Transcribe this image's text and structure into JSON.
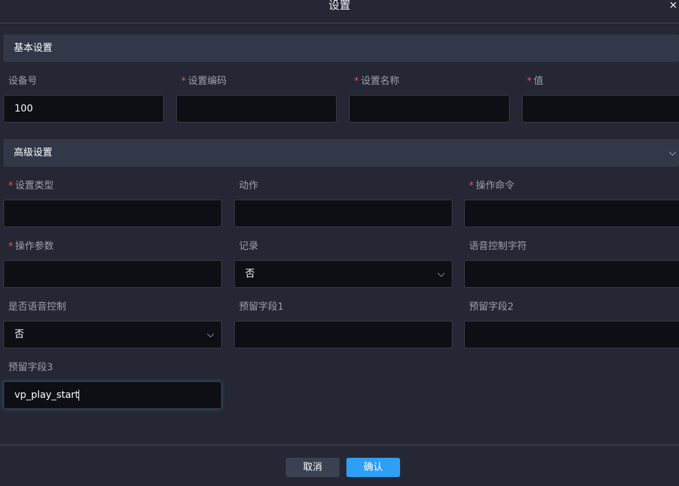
{
  "dialog": {
    "title": "设置",
    "close_icon": "close-icon"
  },
  "basic": {
    "title": "基本设置",
    "fields": [
      {
        "label": "设备号",
        "required": false,
        "value": "100"
      },
      {
        "label": "设置编码",
        "required": true,
        "value": ""
      },
      {
        "label": "设置名称",
        "required": true,
        "value": ""
      },
      {
        "label": "值",
        "required": true,
        "value": ""
      }
    ]
  },
  "advanced": {
    "title": "高级设置",
    "fields": [
      {
        "label": "设置类型",
        "required": true,
        "value": ""
      },
      {
        "label": "动作",
        "required": false,
        "value": ""
      },
      {
        "label": "操作命令",
        "required": true,
        "value": ""
      },
      {
        "label": "操作参数",
        "required": true,
        "value": ""
      },
      {
        "label": "记录",
        "required": false,
        "value": "否",
        "type": "select"
      },
      {
        "label": "语音控制字符",
        "required": false,
        "value": ""
      },
      {
        "label": "是否语音控制",
        "required": false,
        "value": "否",
        "type": "select"
      },
      {
        "label": "预留字段1",
        "required": false,
        "value": ""
      },
      {
        "label": "预留字段2",
        "required": false,
        "value": ""
      },
      {
        "label": "预留字段3",
        "required": false,
        "value": "vp_play_start"
      }
    ]
  },
  "footer": {
    "cancel": "取消",
    "confirm": "确认"
  }
}
